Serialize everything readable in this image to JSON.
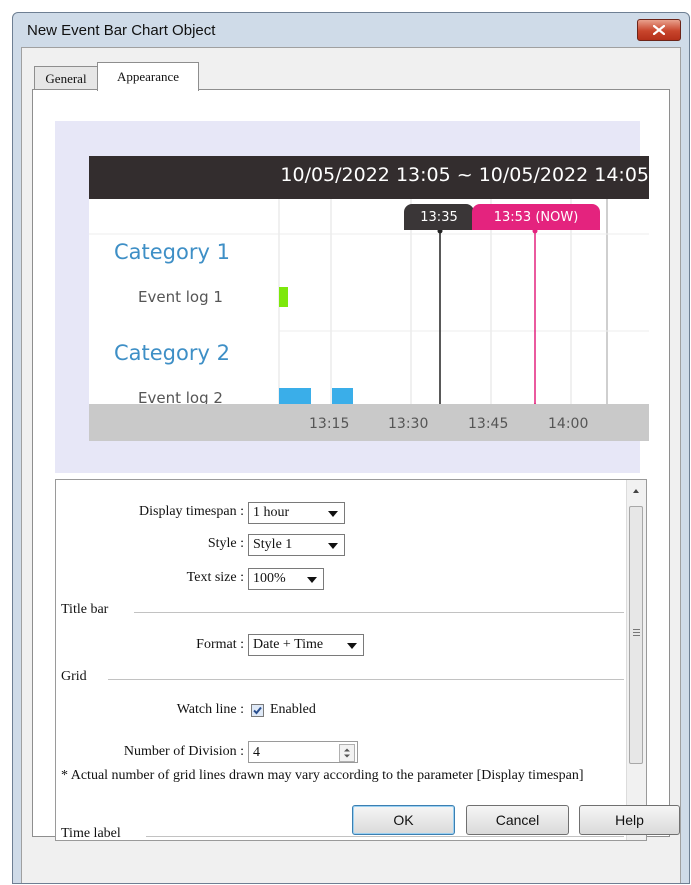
{
  "window": {
    "title": "New Event Bar Chart Object"
  },
  "tabs": [
    {
      "label": "General",
      "active": false
    },
    {
      "label": "Appearance",
      "active": true
    }
  ],
  "preview": {
    "title": "10/05/2022 13:05 ~ 10/05/2022 14:05",
    "watch_label": "13:35",
    "now_label": "13:53 (NOW)",
    "categories": [
      {
        "name": "Category 1",
        "event": "Event log 1"
      },
      {
        "name": "Category 2",
        "event": "Event log 2"
      }
    ],
    "time_ticks": [
      "13:15",
      "13:30",
      "13:45",
      "14:00"
    ],
    "colors": {
      "header": "#332d2e",
      "category": "#3e8fc6",
      "now": "#e4237e",
      "event1": "#7de80b",
      "event2": "#3aaee9",
      "axis": "#c9c9c9"
    }
  },
  "form": {
    "display_timespan": {
      "label": "Display timespan :",
      "value": "1 hour"
    },
    "style": {
      "label": "Style :",
      "value": "Style 1"
    },
    "text_size": {
      "label": "Text size :",
      "value": "100%"
    },
    "title_bar_section": "Title bar",
    "format": {
      "label": "Format :",
      "value": "Date + Time"
    },
    "grid_section": "Grid",
    "watch_line": {
      "label": "Watch line :",
      "checkbox_label": "Enabled",
      "checked": true
    },
    "divisions": {
      "label": "Number of Division :",
      "value": "4"
    },
    "note": "* Actual number of grid lines drawn may vary according to the parameter [Display timespan]",
    "time_label_section": "Time label"
  },
  "buttons": {
    "ok": "OK",
    "cancel": "Cancel",
    "help": "Help"
  }
}
